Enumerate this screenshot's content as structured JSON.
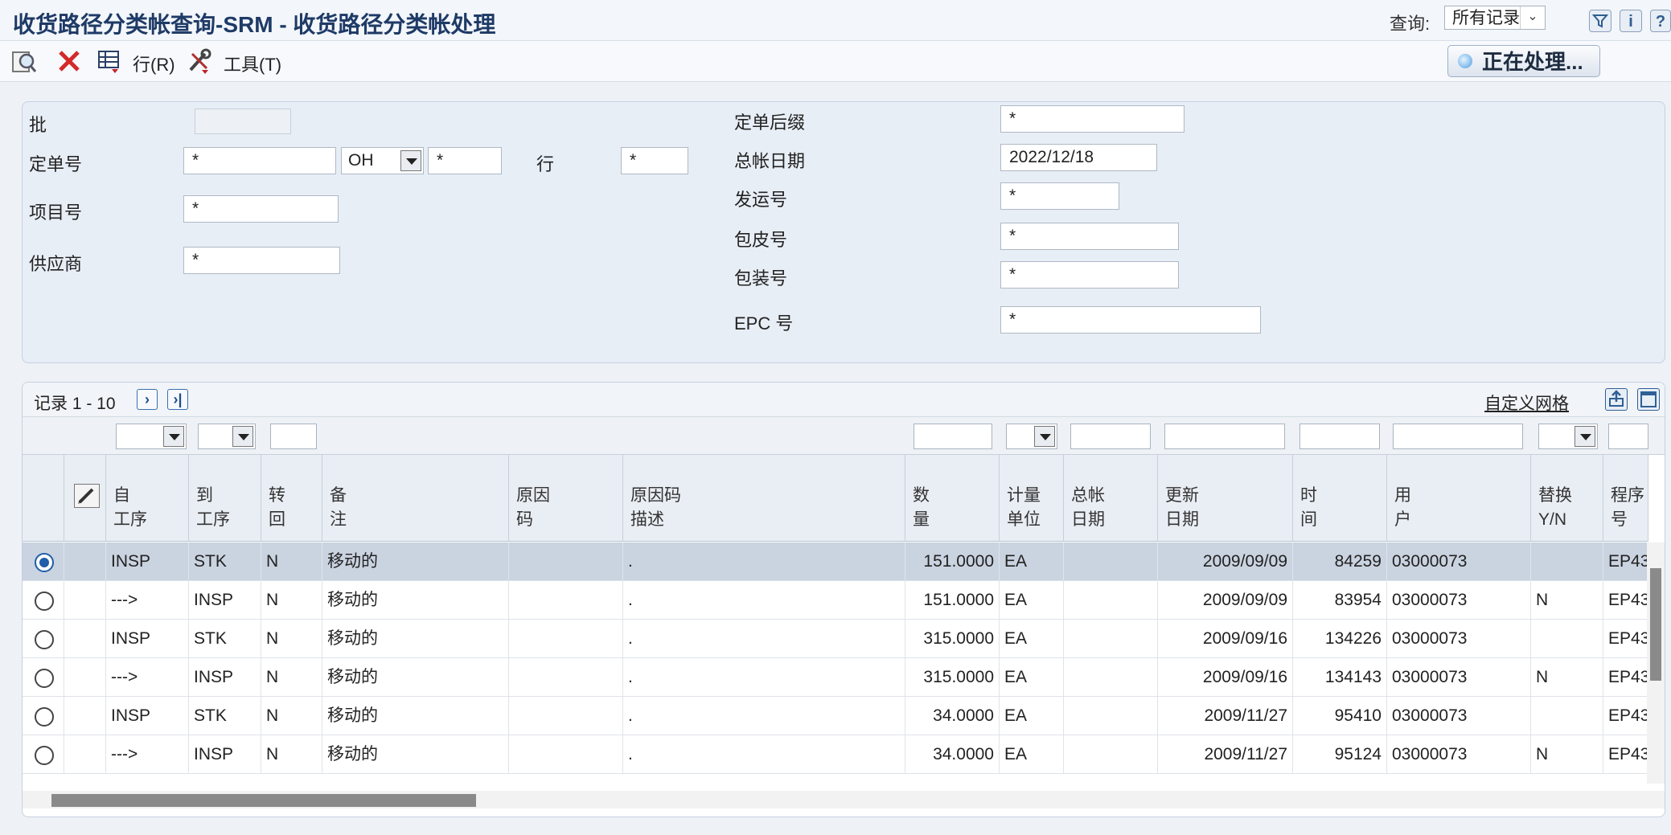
{
  "header": {
    "title": "收货路径分类帐查询-SRM - 收货路径分类帐处理",
    "query_label": "查询:",
    "query_value": "所有记录",
    "icons": [
      "filter-icon",
      "info-icon",
      "help-icon"
    ]
  },
  "toolbar": {
    "row_menu": "行(R)",
    "tools_menu": "工具(T)",
    "processing": "正在处理..."
  },
  "form": {
    "batch_label": "批",
    "order_label": "定单号",
    "order_value": "*",
    "order_type": "OH",
    "order_company": "*",
    "line_label": "行",
    "line_value": "*",
    "item_label": "项目号",
    "item_value": "*",
    "supplier_label": "供应商",
    "supplier_value": "*",
    "suffix_label": "定单后缀",
    "suffix_value": "*",
    "gl_date_label": "总帐日期",
    "gl_date_value": "2022/12/18",
    "shipment_label": "发运号",
    "shipment_value": "*",
    "container_label": "包皮号",
    "container_value": "*",
    "package_label": "包装号",
    "package_value": "*",
    "epc_label": "EPC 号",
    "epc_value": "*"
  },
  "grid": {
    "records_label": "记录 1 - 10",
    "customize_label": "自定义网格",
    "columns": [
      {
        "l1": "自",
        "l2": "工序"
      },
      {
        "l1": "到",
        "l2": "工序"
      },
      {
        "l1": "转",
        "l2": "回"
      },
      {
        "l1": "备",
        "l2": "注"
      },
      {
        "l1": "原因",
        "l2": "码"
      },
      {
        "l1": "原因码",
        "l2": "描述"
      },
      {
        "l1": "数",
        "l2": "量"
      },
      {
        "l1": "计量",
        "l2": "单位"
      },
      {
        "l1": "总帐",
        "l2": "日期"
      },
      {
        "l1": "更新",
        "l2": "日期"
      },
      {
        "l1": "时",
        "l2": "间"
      },
      {
        "l1": "用",
        "l2": "户"
      },
      {
        "l1": "替换",
        "l2": "Y/N"
      },
      {
        "l1": "程序",
        "l2": "号"
      }
    ],
    "rows": [
      {
        "from": "INSP",
        "to": "STK",
        "rev": "N",
        "remark": "移动的",
        "reason": "",
        "reason_desc": ".",
        "qty": "151.0000",
        "uom": "EA",
        "gl": "",
        "upd": "2009/09/09",
        "time": "84259",
        "user": "03000073",
        "repl": "",
        "prog": "EP43"
      },
      {
        "from": "--->",
        "to": "INSP",
        "rev": "N",
        "remark": "移动的",
        "reason": "",
        "reason_desc": ".",
        "qty": "151.0000",
        "uom": "EA",
        "gl": "",
        "upd": "2009/09/09",
        "time": "83954",
        "user": "03000073",
        "repl": "N",
        "prog": "EP43"
      },
      {
        "from": "INSP",
        "to": "STK",
        "rev": "N",
        "remark": "移动的",
        "reason": "",
        "reason_desc": ".",
        "qty": "315.0000",
        "uom": "EA",
        "gl": "",
        "upd": "2009/09/16",
        "time": "134226",
        "user": "03000073",
        "repl": "",
        "prog": "EP43"
      },
      {
        "from": "--->",
        "to": "INSP",
        "rev": "N",
        "remark": "移动的",
        "reason": "",
        "reason_desc": ".",
        "qty": "315.0000",
        "uom": "EA",
        "gl": "",
        "upd": "2009/09/16",
        "time": "134143",
        "user": "03000073",
        "repl": "N",
        "prog": "EP43"
      },
      {
        "from": "INSP",
        "to": "STK",
        "rev": "N",
        "remark": "移动的",
        "reason": "",
        "reason_desc": ".",
        "qty": "34.0000",
        "uom": "EA",
        "gl": "",
        "upd": "2009/11/27",
        "time": "95410",
        "user": "03000073",
        "repl": "",
        "prog": "EP43"
      },
      {
        "from": "--->",
        "to": "INSP",
        "rev": "N",
        "remark": "移动的",
        "reason": "",
        "reason_desc": ".",
        "qty": "34.0000",
        "uom": "EA",
        "gl": "",
        "upd": "2009/11/27",
        "time": "95124",
        "user": "03000073",
        "repl": "N",
        "prog": "EP43"
      }
    ]
  }
}
